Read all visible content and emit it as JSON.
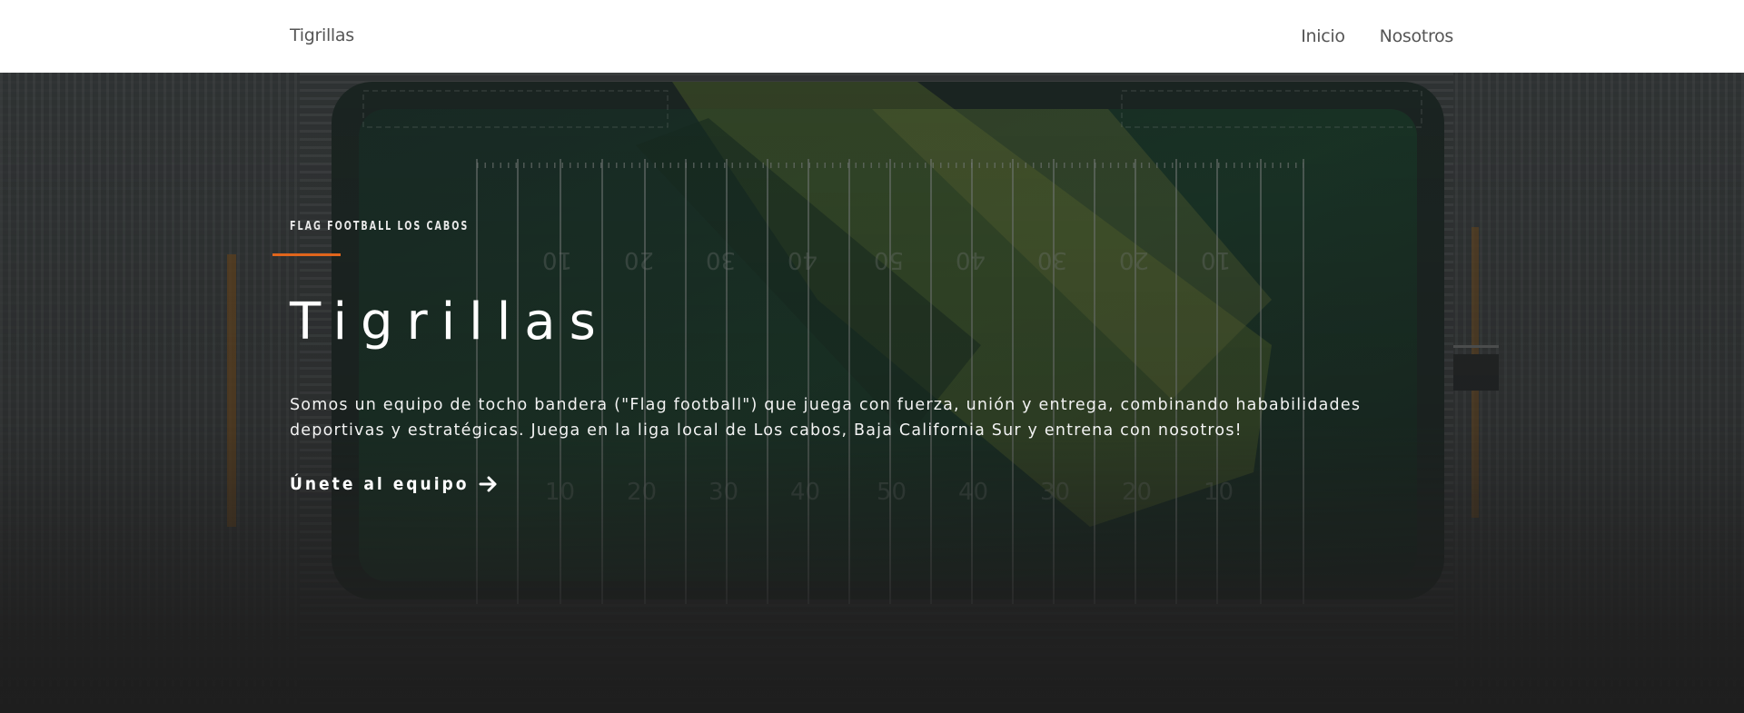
{
  "nav": {
    "brand": "Tigrillas",
    "links": [
      {
        "label": "Inicio"
      },
      {
        "label": "Nosotros"
      }
    ]
  },
  "hero": {
    "eyebrow": "FLAG FOOTBALL LOS CABOS",
    "title": "Tigrillas",
    "description": "Somos un equipo de tocho bandera (\"Flag football\") que juega con fuerza, unión y entrega, combinando hababilidades deportivas y estratégicas. Juega en la liga local de Los cabos, Baja California Sur y entrena con nosotros!",
    "cta_label": "Únete al equipo",
    "cta_icon": "arrow-right-icon",
    "accent_color": "#e0651c",
    "background_image": "aerial-football-field"
  }
}
